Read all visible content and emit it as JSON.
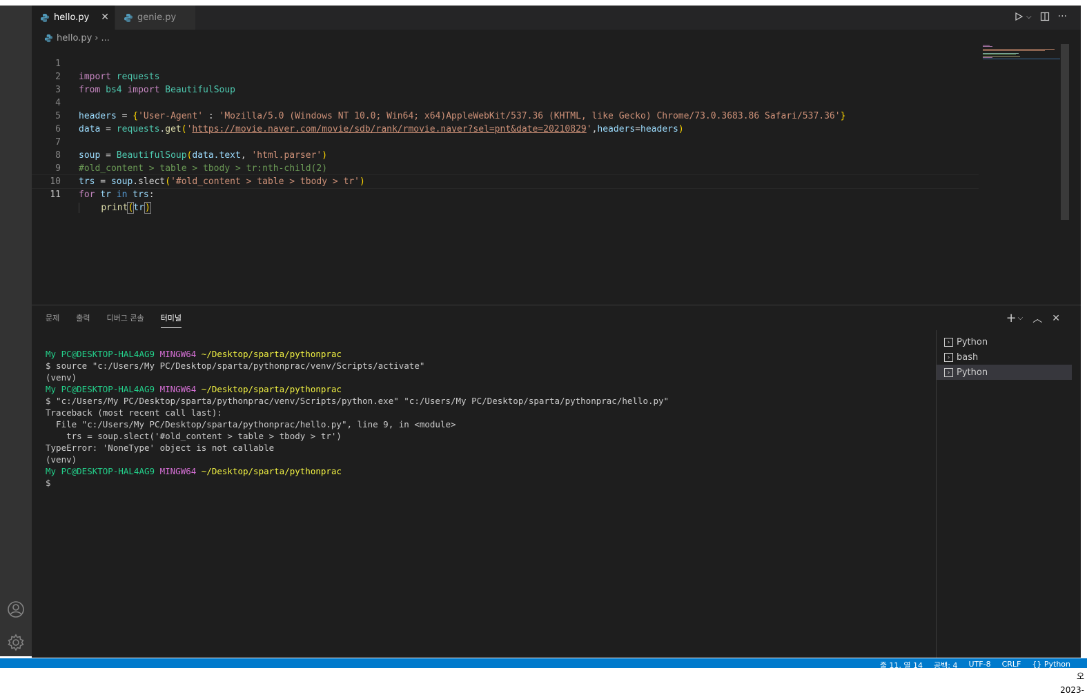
{
  "tabs": [
    {
      "label": "hello.py",
      "active": true
    },
    {
      "label": "genie.py",
      "active": false
    }
  ],
  "breadcrumb": {
    "file": "hello.py",
    "more": "..."
  },
  "editor": {
    "lines": [
      "1",
      "2",
      "3",
      "4",
      "5",
      "6",
      "7",
      "8",
      "9",
      "10",
      "11"
    ],
    "code": {
      "l1_kw": "import",
      "l1_mod": "requests",
      "l2_kw1": "from",
      "l2_mod": "bs4",
      "l2_kw2": "import",
      "l2_cls": "BeautifulSoup",
      "l4_var": "headers",
      "l4_eq": " = ",
      "l4_ob": "{",
      "l4_key": "'User-Agent'",
      "l4_colon": " : ",
      "l4_val": "'Mozilla/5.0 (Windows NT 10.0; Win64; x64)AppleWebKit/537.36 (KHTML, like Gecko) Chrome/73.0.3683.86 Safari/537.36'",
      "l4_cb": "}",
      "l5_var": "data",
      "l5_eq": " = ",
      "l5_mod": "requests",
      "l5_dot": ".",
      "l5_fn": "get",
      "l5_ob": "(",
      "l5_q1": "'",
      "l5_url": "https://movie.naver.com/movie/sdb/rank/rmovie.naver?sel=pnt&date=20210829",
      "l5_q2": "'",
      "l5_comma": ",",
      "l5_kwarg": "headers",
      "l5_eq2": "=",
      "l5_val": "headers",
      "l5_cb": ")",
      "l7_var": "soup",
      "l7_eq": " = ",
      "l7_cls": "BeautifulSoup",
      "l7_ob": "(",
      "l7_arg": "data.text",
      "l7_comma": ", ",
      "l7_str": "'html.parser'",
      "l7_cb": ")",
      "l8_cmt": "#old_content > table > tbody > tr:nth-child(2)",
      "l9_var": "trs",
      "l9_eq": " = ",
      "l9_obj": "soup",
      "l9_dot": ".",
      "l9_fn": "slect",
      "l9_ob": "(",
      "l9_str": "'#old_content > table > tbody > tr'",
      "l9_cb": ")",
      "l10_kw1": "for",
      "l10_v1": "tr",
      "l10_kw2": "in",
      "l10_v2": "trs",
      "l10_colon": ":",
      "l11_indent": "    ",
      "l11_fn": "print",
      "l11_ob": "(",
      "l11_arg": "tr",
      "l11_cb": ")"
    }
  },
  "panel": {
    "tabs": [
      "문제",
      "출력",
      "디버그 콘솔",
      "터미널"
    ],
    "active_tab": "터미널",
    "terminal": {
      "prompt_user": "My PC@DESKTOP-HAL4AG9",
      "prompt_env": "MINGW64",
      "prompt_path": "~/Desktop/sparta/pythonprac",
      "cmd1": "$ source \"c:/Users/My PC/Desktop/sparta/pythonprac/venv/Scripts/activate\"",
      "venv": "(venv)",
      "cmd2": "$ \"c:/Users/My PC/Desktop/sparta/pythonprac/venv/Scripts/python.exe\" \"c:/Users/My PC/Desktop/sparta/pythonprac/hello.py\"",
      "tb1": "Traceback (most recent call last):",
      "tb2": "  File \"c:/Users/My PC/Desktop/sparta/pythonprac/hello.py\", line 9, in <module>",
      "tb3": "    trs = soup.slect('#old_content > table > tbody > tr')",
      "tb4": "TypeError: 'NoneType' object is not callable",
      "final_prompt": "$"
    },
    "terminal_list": [
      "Python",
      "bash",
      "Python"
    ]
  },
  "statusbar": {
    "position": "줄 11, 열 14",
    "spaces": "공백: 4",
    "encoding": "UTF-8",
    "eol": "CRLF",
    "language": "Python"
  },
  "taskbar": {
    "time": "오",
    "date": "2023-"
  },
  "colors": {
    "accent": "#007acc",
    "editor_bg": "#1e1e1e",
    "tab_bg": "#252526"
  }
}
